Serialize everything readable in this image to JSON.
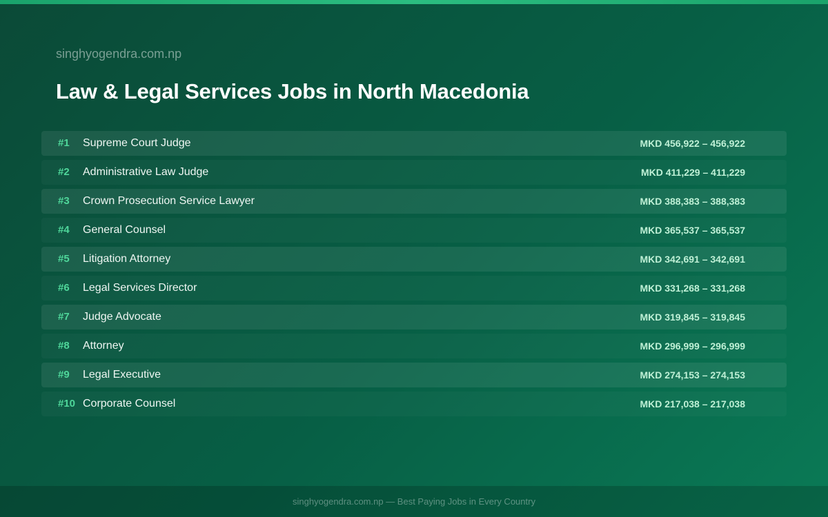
{
  "header": {
    "site": "singhyogendra.com.np",
    "title": "Law & Legal Services Jobs in North Macedonia"
  },
  "jobs": [
    {
      "rank": "#1",
      "title": "Supreme Court Judge",
      "salary": "MKD 456,922 – 456,922"
    },
    {
      "rank": "#2",
      "title": "Administrative Law Judge",
      "salary": "MKD 411,229 – 411,229"
    },
    {
      "rank": "#3",
      "title": "Crown Prosecution Service Lawyer",
      "salary": "MKD 388,383 – 388,383"
    },
    {
      "rank": "#4",
      "title": "General Counsel",
      "salary": "MKD 365,537 – 365,537"
    },
    {
      "rank": "#5",
      "title": "Litigation Attorney",
      "salary": "MKD 342,691 – 342,691"
    },
    {
      "rank": "#6",
      "title": "Legal Services Director",
      "salary": "MKD 331,268 – 331,268"
    },
    {
      "rank": "#7",
      "title": "Judge Advocate",
      "salary": "MKD 319,845 – 319,845"
    },
    {
      "rank": "#8",
      "title": "Attorney",
      "salary": "MKD 296,999 – 296,999"
    },
    {
      "rank": "#9",
      "title": "Legal Executive",
      "salary": "MKD 274,153 – 274,153"
    },
    {
      "rank": "#10",
      "title": "Corporate Counsel",
      "salary": "MKD 217,038 – 217,038"
    }
  ],
  "footer": {
    "text": "singhyogendra.com.np — Best Paying Jobs in Every Country"
  },
  "colors": {
    "accent": "#4fd69a",
    "salary": "#bff0d6",
    "background": "#075f45"
  }
}
